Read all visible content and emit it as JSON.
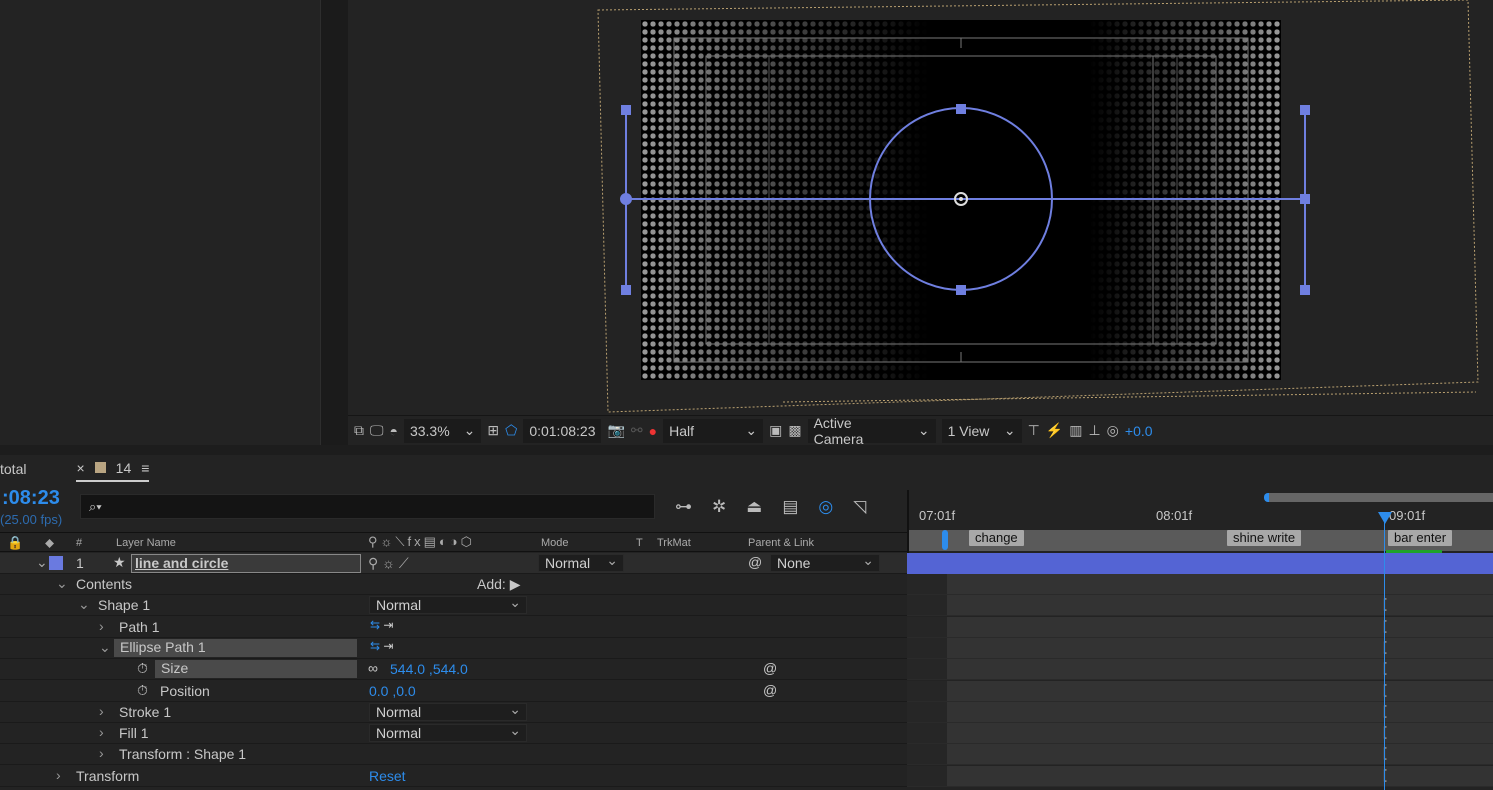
{
  "viewer": {
    "zoom": "33.3%",
    "timecode": "0:01:08:23",
    "resolution": "Half",
    "camera": "Active Camera",
    "views": "1 View",
    "exposure": "+0.0"
  },
  "timeline": {
    "tabs": [
      {
        "label": "total"
      },
      {
        "label": "14",
        "close": "×",
        "menu": "≡",
        "color": "#b9a582"
      }
    ],
    "current_time": ":08:23",
    "fps": "(25.00 fps)",
    "search_placeholder": "",
    "columns": {
      "num": "#",
      "layer_name": "Layer Name",
      "mode": "Mode",
      "t": "T",
      "trkmat": "TrkMat",
      "parent": "Parent & Link"
    },
    "layer": {
      "index": "1",
      "name": "line and circle",
      "mode": "Normal",
      "parent": "None",
      "color": "#6a7ae0"
    },
    "add_label": "Add:",
    "props": [
      {
        "label": "Contents",
        "indent": 0
      },
      {
        "label": "Shape 1",
        "indent": 1,
        "value": "Normal",
        "type": "dropdown"
      },
      {
        "label": "Path 1",
        "indent": 2,
        "type": "pathicons"
      },
      {
        "label": "Ellipse Path 1",
        "indent": 2,
        "type": "pathicons",
        "selected": true
      },
      {
        "label": "Size",
        "indent": 3,
        "value": "544.0 ,544.0",
        "type": "value",
        "stopwatch": true,
        "link": true
      },
      {
        "label": "Position",
        "indent": 3,
        "value": "0.0 ,0.0",
        "type": "value",
        "stopwatch": true
      },
      {
        "label": "Stroke 1",
        "indent": 2,
        "value": "Normal",
        "type": "dropdown"
      },
      {
        "label": "Fill 1",
        "indent": 2,
        "value": "Normal",
        "type": "dropdown"
      },
      {
        "label": "Transform : Shape 1",
        "indent": 2
      },
      {
        "label": "Transform",
        "indent": 0,
        "value": "Reset",
        "type": "link"
      }
    ],
    "ruler": [
      "07:01f",
      "08:01f",
      "09:01f"
    ],
    "markers": [
      "change",
      "shine write",
      "bar enter"
    ],
    "accent": "#2d8ceb",
    "layer_bar_color": "#5464d4"
  }
}
